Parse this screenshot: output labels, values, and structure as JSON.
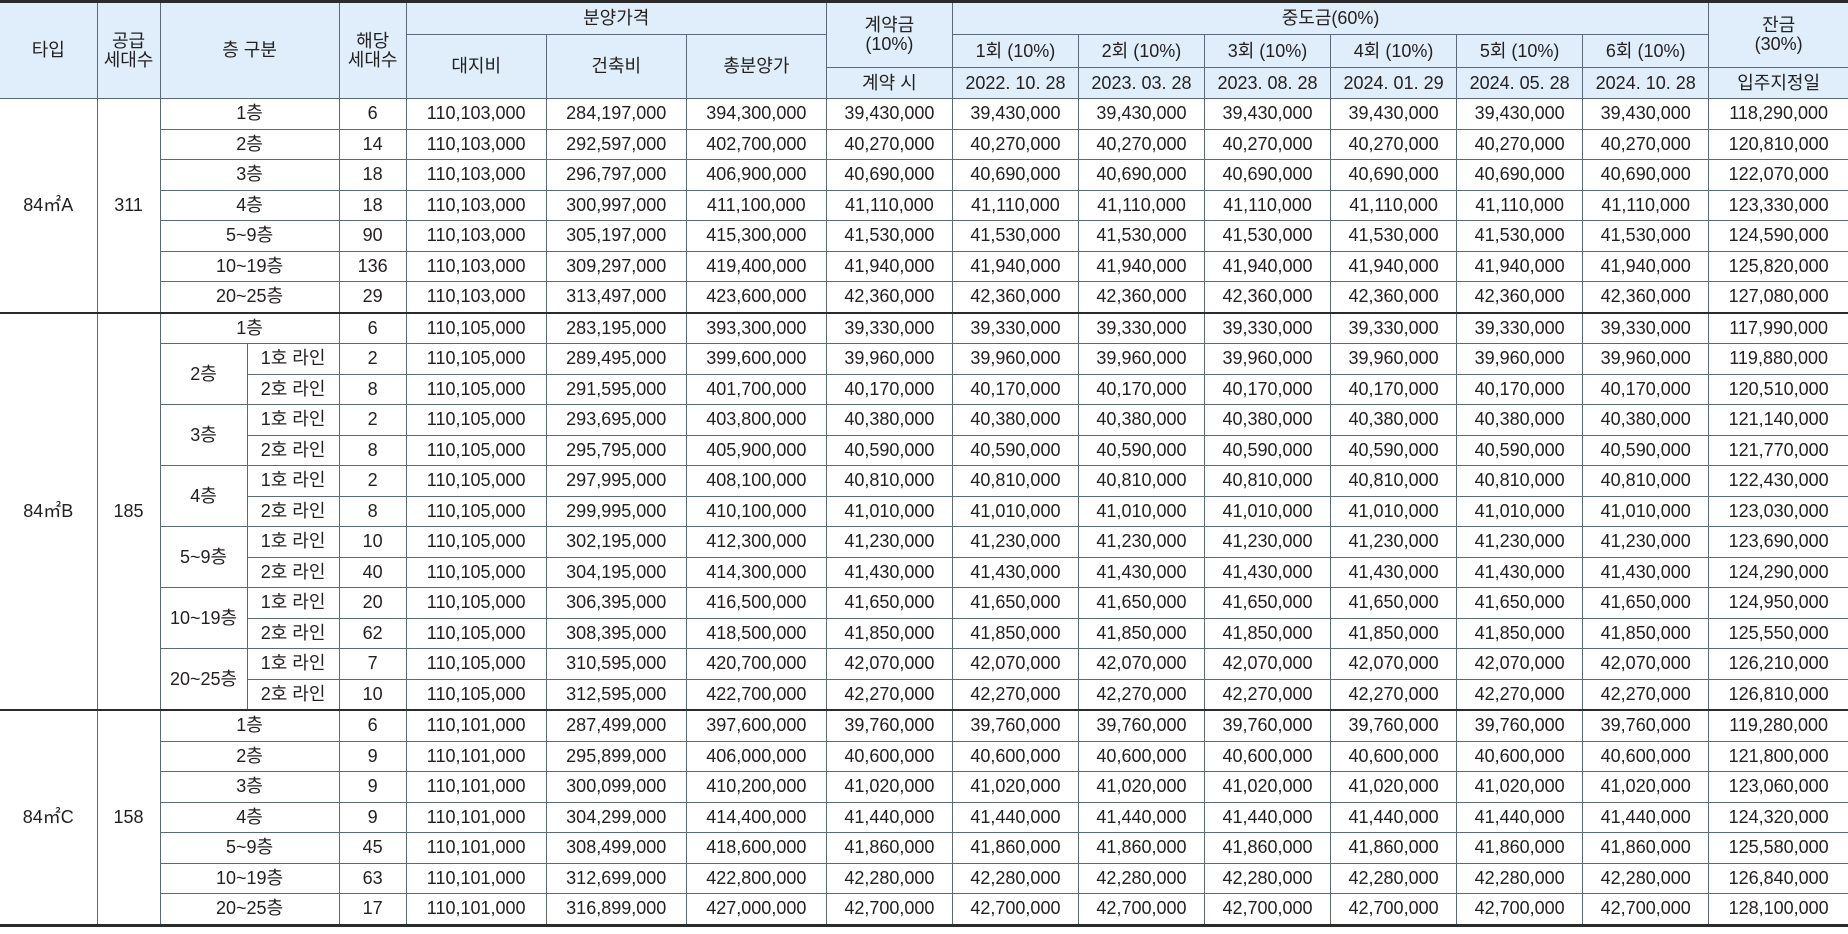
{
  "header": {
    "type": "타입",
    "supply_l1": "공급",
    "supply_l2": "세대수",
    "floor": "층 구분",
    "units_l1": "해당",
    "units_l2": "세대수",
    "price_group": "분양가격",
    "land": "대지비",
    "building": "건축비",
    "total": "총분양가",
    "deposit_l1": "계약금",
    "deposit_l2": "(10%)",
    "deposit_time": "계약 시",
    "middle_group": "중도금(60%)",
    "middle": [
      {
        "label": "1회 (10%)",
        "date": "2022. 10. 28"
      },
      {
        "label": "2회 (10%)",
        "date": "2023. 03. 28"
      },
      {
        "label": "3회 (10%)",
        "date": "2023. 08. 28"
      },
      {
        "label": "4회 (10%)",
        "date": "2024. 01. 29"
      },
      {
        "label": "5회 (10%)",
        "date": "2024. 05. 28"
      },
      {
        "label": "6회 (10%)",
        "date": "2024. 10. 28"
      }
    ],
    "balance_l1": "잔금",
    "balance_l2": "(30%)",
    "balance_time": "입주지정일"
  },
  "groups": [
    {
      "type": "84㎡A",
      "supply": "311",
      "rows": [
        {
          "floor": "1층",
          "line": "",
          "units": "6",
          "land": "110,103,000",
          "building": "284,197,000",
          "total": "394,300,000",
          "deposit": "39,430,000",
          "middle": "39,430,000",
          "balance": "118,290,000"
        },
        {
          "floor": "2층",
          "line": "",
          "units": "14",
          "land": "110,103,000",
          "building": "292,597,000",
          "total": "402,700,000",
          "deposit": "40,270,000",
          "middle": "40,270,000",
          "balance": "120,810,000"
        },
        {
          "floor": "3층",
          "line": "",
          "units": "18",
          "land": "110,103,000",
          "building": "296,797,000",
          "total": "406,900,000",
          "deposit": "40,690,000",
          "middle": "40,690,000",
          "balance": "122,070,000"
        },
        {
          "floor": "4층",
          "line": "",
          "units": "18",
          "land": "110,103,000",
          "building": "300,997,000",
          "total": "411,100,000",
          "deposit": "41,110,000",
          "middle": "41,110,000",
          "balance": "123,330,000"
        },
        {
          "floor": "5~9층",
          "line": "",
          "units": "90",
          "land": "110,103,000",
          "building": "305,197,000",
          "total": "415,300,000",
          "deposit": "41,530,000",
          "middle": "41,530,000",
          "balance": "124,590,000"
        },
        {
          "floor": "10~19층",
          "line": "",
          "units": "136",
          "land": "110,103,000",
          "building": "309,297,000",
          "total": "419,400,000",
          "deposit": "41,940,000",
          "middle": "41,940,000",
          "balance": "125,820,000"
        },
        {
          "floor": "20~25층",
          "line": "",
          "units": "29",
          "land": "110,103,000",
          "building": "313,497,000",
          "total": "423,600,000",
          "deposit": "42,360,000",
          "middle": "42,360,000",
          "balance": "127,080,000"
        }
      ]
    },
    {
      "type": "84㎡B",
      "supply": "185",
      "rows": [
        {
          "floor": "1층",
          "line": "",
          "units": "6",
          "land": "110,105,000",
          "building": "283,195,000",
          "total": "393,300,000",
          "deposit": "39,330,000",
          "middle": "39,330,000",
          "balance": "117,990,000"
        },
        {
          "floor": "2층",
          "line": "1호 라인",
          "units": "2",
          "land": "110,105,000",
          "building": "289,495,000",
          "total": "399,600,000",
          "deposit": "39,960,000",
          "middle": "39,960,000",
          "balance": "119,880,000"
        },
        {
          "floor": "2층",
          "line": "2호 라인",
          "units": "8",
          "land": "110,105,000",
          "building": "291,595,000",
          "total": "401,700,000",
          "deposit": "40,170,000",
          "middle": "40,170,000",
          "balance": "120,510,000"
        },
        {
          "floor": "3층",
          "line": "1호 라인",
          "units": "2",
          "land": "110,105,000",
          "building": "293,695,000",
          "total": "403,800,000",
          "deposit": "40,380,000",
          "middle": "40,380,000",
          "balance": "121,140,000"
        },
        {
          "floor": "3층",
          "line": "2호 라인",
          "units": "8",
          "land": "110,105,000",
          "building": "295,795,000",
          "total": "405,900,000",
          "deposit": "40,590,000",
          "middle": "40,590,000",
          "balance": "121,770,000"
        },
        {
          "floor": "4층",
          "line": "1호 라인",
          "units": "2",
          "land": "110,105,000",
          "building": "297,995,000",
          "total": "408,100,000",
          "deposit": "40,810,000",
          "middle": "40,810,000",
          "balance": "122,430,000"
        },
        {
          "floor": "4층",
          "line": "2호 라인",
          "units": "8",
          "land": "110,105,000",
          "building": "299,995,000",
          "total": "410,100,000",
          "deposit": "41,010,000",
          "middle": "41,010,000",
          "balance": "123,030,000"
        },
        {
          "floor": "5~9층",
          "line": "1호 라인",
          "units": "10",
          "land": "110,105,000",
          "building": "302,195,000",
          "total": "412,300,000",
          "deposit": "41,230,000",
          "middle": "41,230,000",
          "balance": "123,690,000"
        },
        {
          "floor": "5~9층",
          "line": "2호 라인",
          "units": "40",
          "land": "110,105,000",
          "building": "304,195,000",
          "total": "414,300,000",
          "deposit": "41,430,000",
          "middle": "41,430,000",
          "balance": "124,290,000"
        },
        {
          "floor": "10~19층",
          "line": "1호 라인",
          "units": "20",
          "land": "110,105,000",
          "building": "306,395,000",
          "total": "416,500,000",
          "deposit": "41,650,000",
          "middle": "41,650,000",
          "balance": "124,950,000"
        },
        {
          "floor": "10~19층",
          "line": "2호 라인",
          "units": "62",
          "land": "110,105,000",
          "building": "308,395,000",
          "total": "418,500,000",
          "deposit": "41,850,000",
          "middle": "41,850,000",
          "balance": "125,550,000"
        },
        {
          "floor": "20~25층",
          "line": "1호 라인",
          "units": "7",
          "land": "110,105,000",
          "building": "310,595,000",
          "total": "420,700,000",
          "deposit": "42,070,000",
          "middle": "42,070,000",
          "balance": "126,210,000"
        },
        {
          "floor": "20~25층",
          "line": "2호 라인",
          "units": "10",
          "land": "110,105,000",
          "building": "312,595,000",
          "total": "422,700,000",
          "deposit": "42,270,000",
          "middle": "42,270,000",
          "balance": "126,810,000"
        }
      ]
    },
    {
      "type": "84㎡C",
      "supply": "158",
      "rows": [
        {
          "floor": "1층",
          "line": "",
          "units": "6",
          "land": "110,101,000",
          "building": "287,499,000",
          "total": "397,600,000",
          "deposit": "39,760,000",
          "middle": "39,760,000",
          "balance": "119,280,000"
        },
        {
          "floor": "2층",
          "line": "",
          "units": "9",
          "land": "110,101,000",
          "building": "295,899,000",
          "total": "406,000,000",
          "deposit": "40,600,000",
          "middle": "40,600,000",
          "balance": "121,800,000"
        },
        {
          "floor": "3층",
          "line": "",
          "units": "9",
          "land": "110,101,000",
          "building": "300,099,000",
          "total": "410,200,000",
          "deposit": "41,020,000",
          "middle": "41,020,000",
          "balance": "123,060,000"
        },
        {
          "floor": "4층",
          "line": "",
          "units": "9",
          "land": "110,101,000",
          "building": "304,299,000",
          "total": "414,400,000",
          "deposit": "41,440,000",
          "middle": "41,440,000",
          "balance": "124,320,000"
        },
        {
          "floor": "5~9층",
          "line": "",
          "units": "45",
          "land": "110,101,000",
          "building": "308,499,000",
          "total": "418,600,000",
          "deposit": "41,860,000",
          "middle": "41,860,000",
          "balance": "125,580,000"
        },
        {
          "floor": "10~19층",
          "line": "",
          "units": "63",
          "land": "110,101,000",
          "building": "312,699,000",
          "total": "422,800,000",
          "deposit": "42,280,000",
          "middle": "42,280,000",
          "balance": "126,840,000"
        },
        {
          "floor": "20~25층",
          "line": "",
          "units": "17",
          "land": "110,101,000",
          "building": "316,899,000",
          "total": "427,000,000",
          "deposit": "42,700,000",
          "middle": "42,700,000",
          "balance": "128,100,000"
        }
      ]
    }
  ]
}
